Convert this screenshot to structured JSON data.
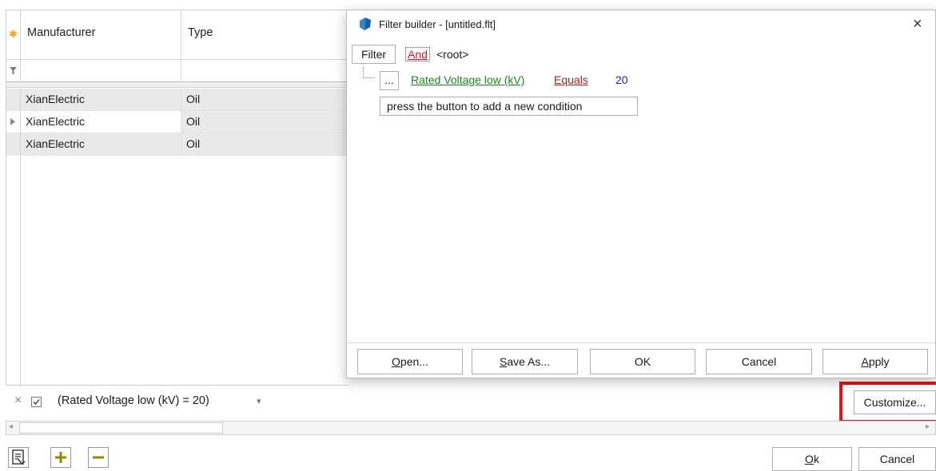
{
  "grid": {
    "columns": [
      "Manufacturer",
      "Type"
    ],
    "rows": [
      {
        "manufacturer": "XianElectric",
        "type": "Oil"
      },
      {
        "manufacturer": "XianElectric",
        "type": "Oil"
      },
      {
        "manufacturer": "XianElectric",
        "type": "Oil"
      }
    ]
  },
  "filter_bar": {
    "text": "(Rated Voltage low (kV) = 20)",
    "customize_label": "Customize..."
  },
  "dialog": {
    "title": "Filter builder - [untitled.flt]",
    "filter_button": "Filter",
    "and_label": "And",
    "root_label": "<root>",
    "condition": {
      "ellipsis": "...",
      "field": "Rated Voltage low (kV)",
      "operator": "Equals",
      "value": "20"
    },
    "add_condition_hint": "press the button to add a new condition",
    "buttons": {
      "open_pre": "",
      "open_u": "O",
      "open_post": "pen...",
      "save_pre": "",
      "save_u": "S",
      "save_post": "ave As...",
      "ok": "OK",
      "cancel": "Cancel",
      "apply_pre": "",
      "apply_u": "A",
      "apply_post": "pply"
    }
  },
  "footer": {
    "ok_u": "O",
    "ok_post": "k",
    "cancel": "Cancel"
  },
  "colors": {
    "highlight": "#e8121c",
    "link_green": "#1a8a1a",
    "link_red": "#b22222",
    "value_blue": "#1a1ae6",
    "star_orange": "#f5a623"
  }
}
